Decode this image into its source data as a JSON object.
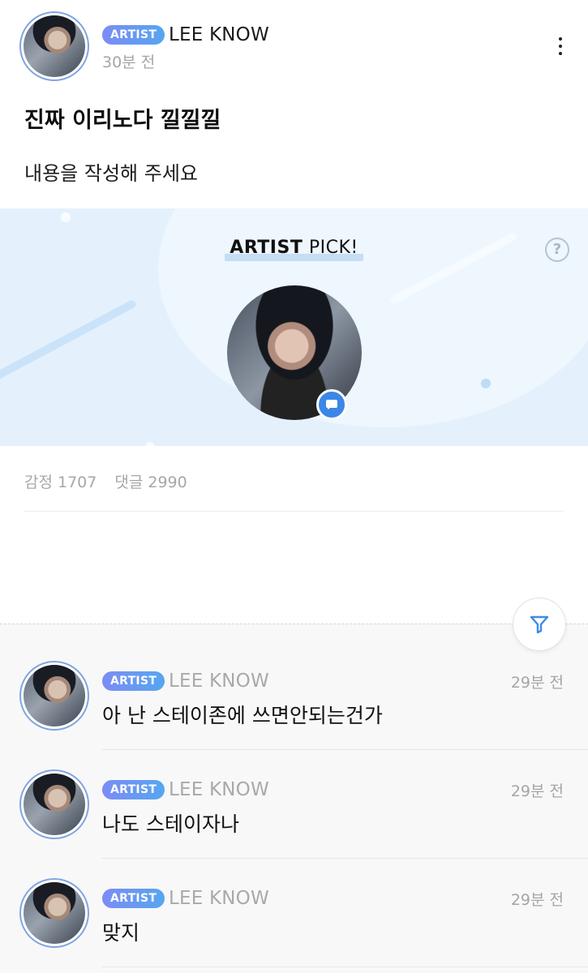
{
  "post": {
    "badge": "ARTIST",
    "author": "LEE KNOW",
    "time": "30분 전",
    "title": "진짜 이리노다 낄낄낄",
    "body": "내용을 작성해 주세요",
    "more_icon": "more-vertical-icon"
  },
  "artist_pick": {
    "title_strong": "ARTIST",
    "title_rest": " PICK!",
    "help_label": "?",
    "chat_icon": "chat-bubble-icon"
  },
  "stats": {
    "reactions": "감정 1707",
    "comments": "댓글 2990"
  },
  "filter_icon": "filter-icon",
  "comments": [
    {
      "badge": "ARTIST",
      "author": "LEE KNOW",
      "time": "29분 전",
      "text": "아 난 스테이존에 쓰면안되는건가"
    },
    {
      "badge": "ARTIST",
      "author": "LEE KNOW",
      "time": "29분 전",
      "text": "나도 스테이자나"
    },
    {
      "badge": "ARTIST",
      "author": "LEE KNOW",
      "time": "29분 전",
      "text": "맞지"
    }
  ],
  "colors": {
    "badge_start": "#7b8cf5",
    "badge_end": "#56a6ef",
    "banner_bg": "#e4f1fd",
    "accent_blue": "#3c86e8"
  }
}
